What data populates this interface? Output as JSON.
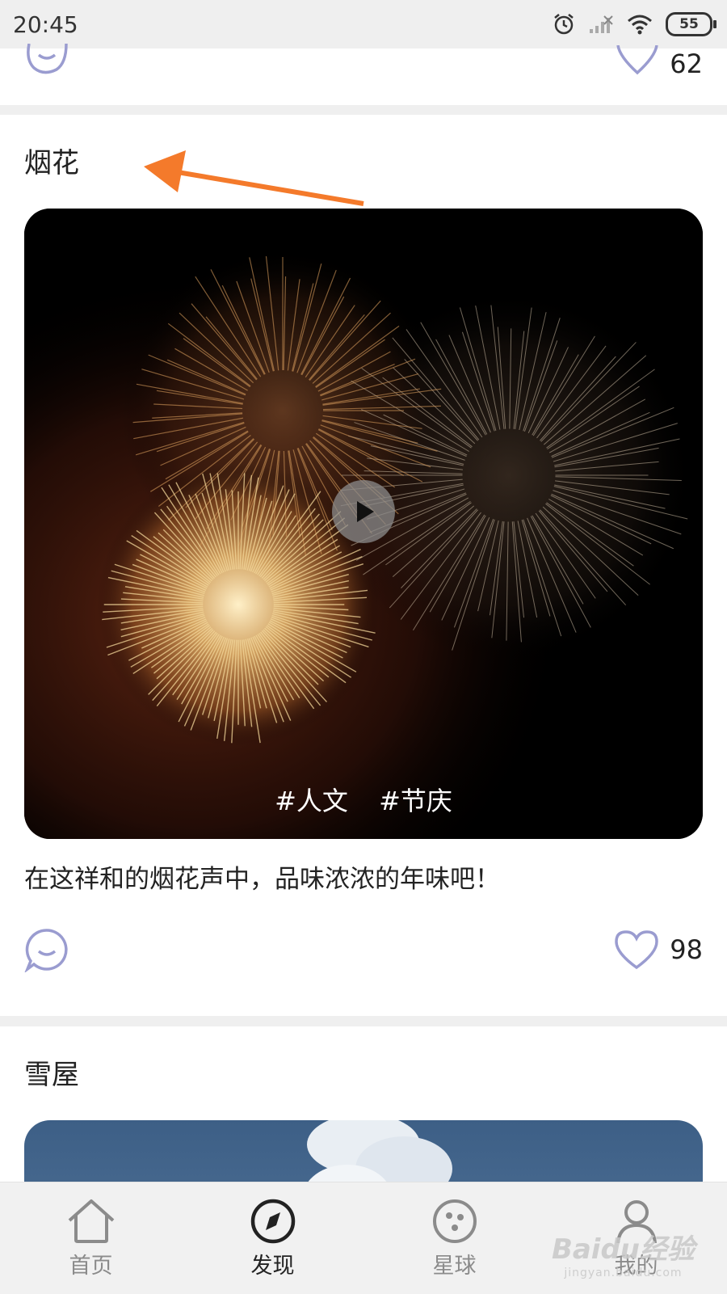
{
  "status_bar": {
    "time": "20:45",
    "battery": "55"
  },
  "previous_post": {
    "like_count": "62"
  },
  "post": {
    "title": "烟花",
    "tags": [
      "#人文",
      "#节庆"
    ],
    "description": "在这祥和的烟花声中，品味浓浓的年味吧！",
    "like_count": "98"
  },
  "next_post": {
    "title": "雪屋"
  },
  "tab_bar": {
    "tabs": [
      {
        "label": "首页",
        "icon": "home-icon"
      },
      {
        "label": "发现",
        "icon": "compass-icon"
      },
      {
        "label": "星球",
        "icon": "planet-icon"
      },
      {
        "label": "我的",
        "icon": "person-icon"
      }
    ],
    "active": "发现"
  },
  "watermark": {
    "brand": "Baidu经验",
    "url": "jingyan.baidu.com"
  },
  "colors": {
    "icon_accent": "#9a9cd0",
    "annotation_arrow": "#f47a2b",
    "active_tab": "#222222",
    "inactive_tab": "#8b8b8b"
  }
}
